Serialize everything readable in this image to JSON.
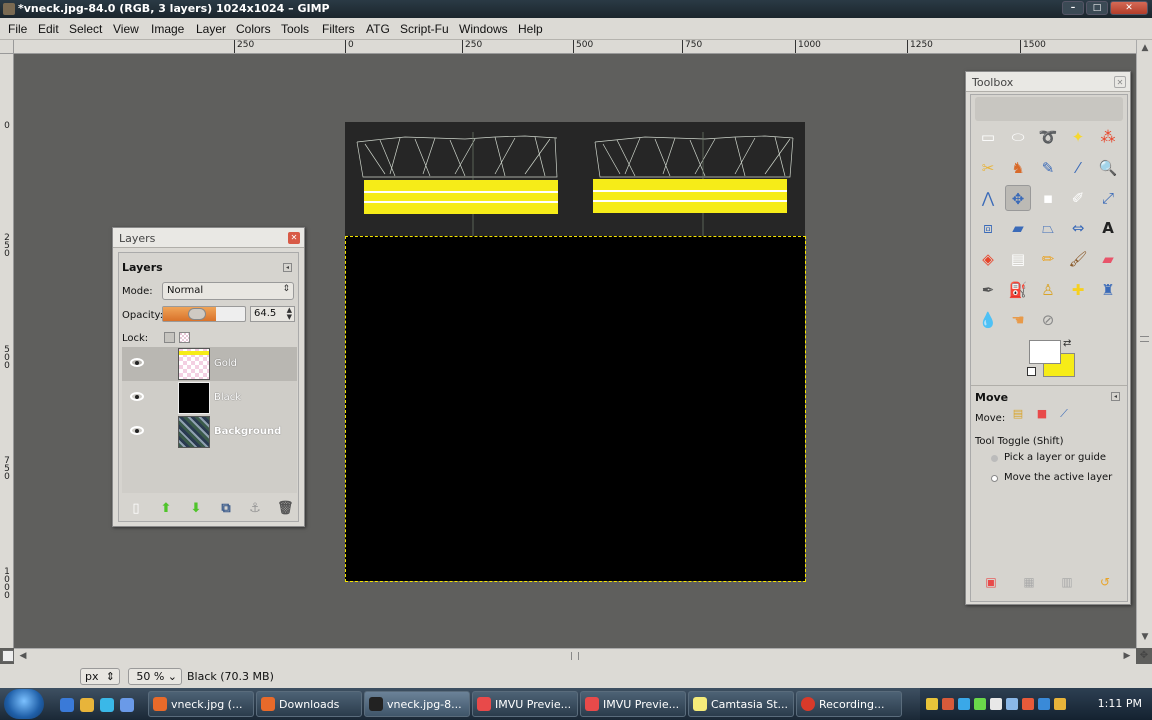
{
  "window": {
    "title": "*vneck.jpg-84.0 (RGB, 3 layers) 1024x1024 – GIMP",
    "min_label": "–",
    "max_label": "□",
    "close_label": "✕"
  },
  "menu": [
    "File",
    "Edit",
    "Select",
    "View",
    "Image",
    "Layer",
    "Colors",
    "Tools",
    "Filters",
    "ATG",
    "Script-Fu",
    "Windows",
    "Help"
  ],
  "ruler_top": [
    "250",
    "0",
    "250",
    "500",
    "750",
    "1000",
    "1250",
    "1500"
  ],
  "ruler_left": [
    "0",
    "2\n5\n0",
    "5\n0\n0",
    "7\n5\n0",
    "1\n0\n0\n0"
  ],
  "status": {
    "unit": "px",
    "zoom": "50 %",
    "message": "Black (70.3 MB)"
  },
  "layers_dialog": {
    "title": "Layers",
    "header": "Layers",
    "mode_label": "Mode:",
    "mode_value": "Normal",
    "opacity_label": "Opacity:",
    "opacity_value": "64.5",
    "opacity_fraction": 0.645,
    "lock_label": "Lock:",
    "layers": [
      {
        "name": "Gold",
        "visible": true,
        "selected": true
      },
      {
        "name": "Black",
        "visible": true,
        "selected": false
      },
      {
        "name": "Background",
        "visible": true,
        "selected": false
      }
    ],
    "buttons": [
      "new-layer-icon",
      "raise-layer-icon",
      "lower-layer-icon",
      "duplicate-layer-icon",
      "anchor-layer-icon",
      "delete-layer-icon"
    ]
  },
  "toolbox": {
    "title": "Toolbox",
    "tool_options_title": "Move",
    "move_label": "Move:",
    "toggle_label": "Tool Toggle  (Shift)",
    "option_pick": "Pick a layer or guide",
    "option_move": "Move the active layer",
    "fg_color": "#ffffff",
    "bg_color": "#f6ec18"
  },
  "taskbar": {
    "tasks": [
      "vneck.jpg (...",
      "Downloads",
      "vneck.jpg-8...",
      "IMVU Previe...",
      "IMVU Previe...",
      "Camtasia St...",
      "Recording..."
    ],
    "clock": "1:11 PM"
  }
}
